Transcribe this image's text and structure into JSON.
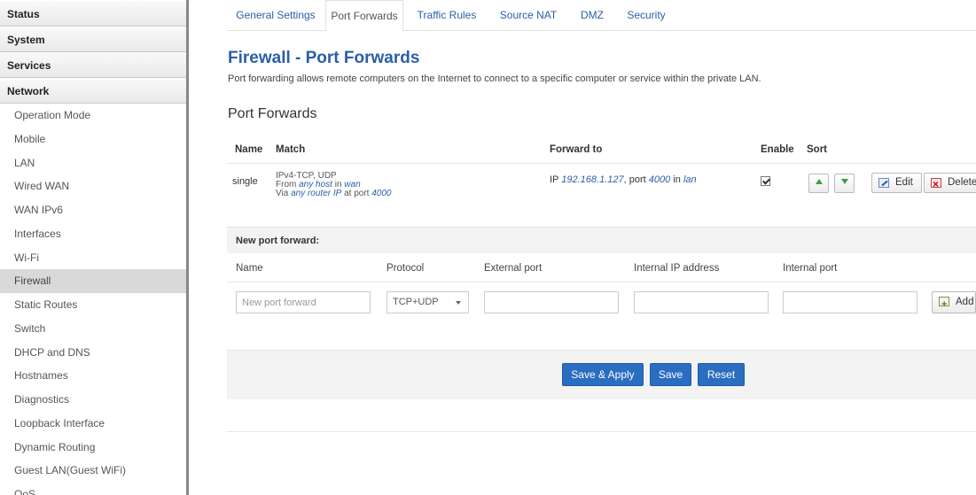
{
  "sidebar": {
    "categories": [
      "Status",
      "System",
      "Services",
      "Network"
    ],
    "items": [
      "Operation Mode",
      "Mobile",
      "LAN",
      "Wired WAN",
      "WAN IPv6",
      "Interfaces",
      "Wi-Fi",
      "Firewall",
      "Static Routes",
      "Switch",
      "DHCP and DNS",
      "Hostnames",
      "Diagnostics",
      "Loopback Interface",
      "Dynamic Routing",
      "Guest LAN(Guest WiFi)",
      "QoS"
    ],
    "active_item": "Firewall"
  },
  "tabs": [
    "General Settings",
    "Port Forwards",
    "Traffic Rules",
    "Source NAT",
    "DMZ",
    "Security"
  ],
  "active_tab": "Port Forwards",
  "page": {
    "title": "Firewall - Port Forwards",
    "description": "Port forwarding allows remote computers on the Internet to connect to a specific computer or service within the private LAN.",
    "section_title": "Port Forwards"
  },
  "table": {
    "headers": {
      "name": "Name",
      "match": "Match",
      "forward_to": "Forward to",
      "enable": "Enable",
      "sort": "Sort"
    },
    "rows": [
      {
        "name": "single",
        "match_line1": "IPv4-TCP, UDP",
        "match_from_prefix": "From",
        "match_from_host": "any host",
        "match_in": "in",
        "match_zone": "wan",
        "match_via_prefix": "Via",
        "match_via_ip": "any router IP",
        "match_at_port": "at port",
        "match_port": "4000",
        "fwd_ip_prefix": "IP",
        "fwd_ip": "192.168.1.127",
        "fwd_port_prefix": ", port",
        "fwd_port": "4000",
        "fwd_in": "in",
        "fwd_zone": "lan",
        "enabled": true,
        "edit_label": "Edit",
        "delete_label": "Delete"
      }
    ]
  },
  "new_forward": {
    "header": "New port forward:",
    "columns": {
      "name": "Name",
      "protocol": "Protocol",
      "external_port": "External port",
      "internal_ip": "Internal IP address",
      "internal_port": "Internal port"
    },
    "name_placeholder": "New port forward",
    "protocol_value": "TCP+UDP",
    "add_label": "Add"
  },
  "footer": {
    "save_apply": "Save & Apply",
    "save": "Save",
    "reset": "Reset"
  }
}
